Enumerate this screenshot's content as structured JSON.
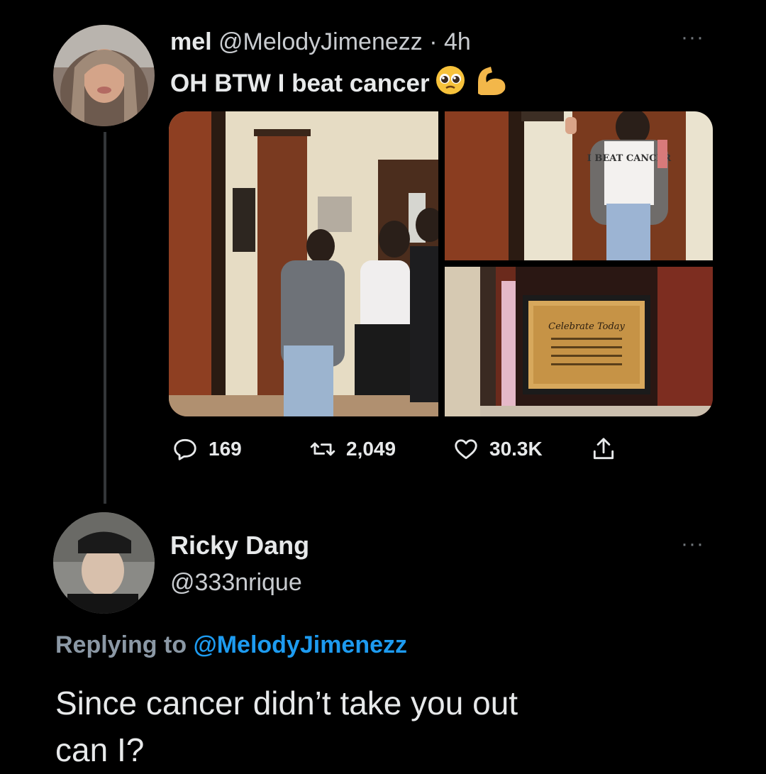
{
  "tweet": {
    "author_name": "mel",
    "author_handle": "@MelodyJimenezz",
    "separator": " · ",
    "time": "4h",
    "text": "OH BTW I beat cancer",
    "emojis": [
      "pleading-face",
      "flexed-biceps"
    ],
    "media": {
      "shirt_text": "I BEAT CANCER",
      "plaque_title": "Celebrate Today"
    },
    "actions": {
      "replies": "169",
      "retweets": "2,049",
      "likes": "30.3K"
    },
    "more_label": "···"
  },
  "reply": {
    "author_name": "Ricky Dang",
    "author_handle": "@333nrique",
    "replying_prefix": "Replying to ",
    "replying_to": "@MelodyJimenezz",
    "text_line1": "Since cancer didn’t take you out",
    "text_line2": "can I?",
    "more_label": "···"
  },
  "colors": {
    "background": "#000000",
    "text": "#e7e9ea",
    "muted": "#71767b",
    "link": "#1d9bf0"
  }
}
